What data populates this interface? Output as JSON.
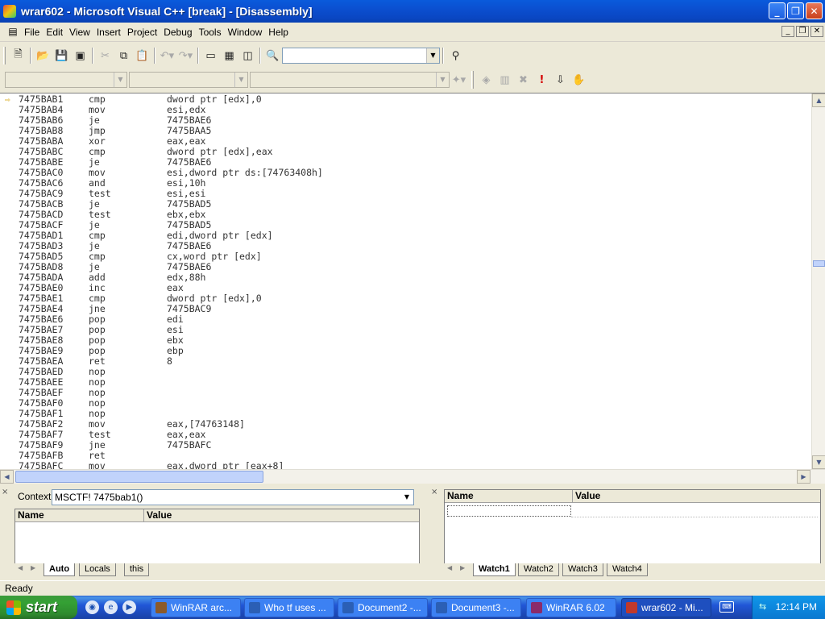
{
  "window": {
    "title": "wrar602 - Microsoft Visual C++ [break] - [Disassembly]"
  },
  "menu": [
    "File",
    "Edit",
    "View",
    "Insert",
    "Project",
    "Debug",
    "Tools",
    "Window",
    "Help"
  ],
  "disassembly": [
    {
      "addr": "7475BAB1",
      "mn": "cmp",
      "op": "dword ptr [edx],0",
      "current": true
    },
    {
      "addr": "7475BAB4",
      "mn": "mov",
      "op": "esi,edx"
    },
    {
      "addr": "7475BAB6",
      "mn": "je",
      "op": "7475BAE6"
    },
    {
      "addr": "7475BAB8",
      "mn": "jmp",
      "op": "7475BAA5"
    },
    {
      "addr": "7475BABA",
      "mn": "xor",
      "op": "eax,eax"
    },
    {
      "addr": "7475BABC",
      "mn": "cmp",
      "op": "dword ptr [edx],eax"
    },
    {
      "addr": "7475BABE",
      "mn": "je",
      "op": "7475BAE6"
    },
    {
      "addr": "7475BAC0",
      "mn": "mov",
      "op": "esi,dword ptr ds:[74763408h]"
    },
    {
      "addr": "7475BAC6",
      "mn": "and",
      "op": "esi,10h"
    },
    {
      "addr": "7475BAC9",
      "mn": "test",
      "op": "esi,esi"
    },
    {
      "addr": "7475BACB",
      "mn": "je",
      "op": "7475BAD5"
    },
    {
      "addr": "7475BACD",
      "mn": "test",
      "op": "ebx,ebx"
    },
    {
      "addr": "7475BACF",
      "mn": "je",
      "op": "7475BAD5"
    },
    {
      "addr": "7475BAD1",
      "mn": "cmp",
      "op": "edi,dword ptr [edx]"
    },
    {
      "addr": "7475BAD3",
      "mn": "je",
      "op": "7475BAE6"
    },
    {
      "addr": "7475BAD5",
      "mn": "cmp",
      "op": "cx,word ptr [edx]"
    },
    {
      "addr": "7475BAD8",
      "mn": "je",
      "op": "7475BAE6"
    },
    {
      "addr": "7475BADA",
      "mn": "add",
      "op": "edx,88h"
    },
    {
      "addr": "7475BAE0",
      "mn": "inc",
      "op": "eax"
    },
    {
      "addr": "7475BAE1",
      "mn": "cmp",
      "op": "dword ptr [edx],0"
    },
    {
      "addr": "7475BAE4",
      "mn": "jne",
      "op": "7475BAC9"
    },
    {
      "addr": "7475BAE6",
      "mn": "pop",
      "op": "edi"
    },
    {
      "addr": "7475BAE7",
      "mn": "pop",
      "op": "esi"
    },
    {
      "addr": "7475BAE8",
      "mn": "pop",
      "op": "ebx"
    },
    {
      "addr": "7475BAE9",
      "mn": "pop",
      "op": "ebp"
    },
    {
      "addr": "7475BAEA",
      "mn": "ret",
      "op": "8"
    },
    {
      "addr": "7475BAED",
      "mn": "nop",
      "op": ""
    },
    {
      "addr": "7475BAEE",
      "mn": "nop",
      "op": ""
    },
    {
      "addr": "7475BAEF",
      "mn": "nop",
      "op": ""
    },
    {
      "addr": "7475BAF0",
      "mn": "nop",
      "op": ""
    },
    {
      "addr": "7475BAF1",
      "mn": "nop",
      "op": ""
    },
    {
      "addr": "7475BAF2",
      "mn": "mov",
      "op": "eax,[74763148]"
    },
    {
      "addr": "7475BAF7",
      "mn": "test",
      "op": "eax,eax"
    },
    {
      "addr": "7475BAF9",
      "mn": "jne",
      "op": "7475BAFC"
    },
    {
      "addr": "7475BAFB",
      "mn": "ret",
      "op": ""
    },
    {
      "addr": "7475BAFC",
      "mn": "mov",
      "op": "eax,dword ptr [eax+8]"
    }
  ],
  "variables": {
    "context_label": "Context:",
    "context_value": "MSCTF! 7475bab1()",
    "col_name": "Name",
    "col_value": "Value",
    "tabs": [
      "Auto",
      "Locals",
      "this"
    ]
  },
  "watch": {
    "col_name": "Name",
    "col_value": "Value",
    "tabs": [
      "Watch1",
      "Watch2",
      "Watch3",
      "Watch4"
    ]
  },
  "status": {
    "text": "Ready"
  },
  "taskbar": {
    "start_label": "start",
    "tasks": [
      {
        "label": "WinRAR arc...",
        "icon_color": "#8b5a2b"
      },
      {
        "label": "Who tf uses ...",
        "icon_color": "#2b5fb5"
      },
      {
        "label": "Document2 -...",
        "icon_color": "#2b5fb5"
      },
      {
        "label": "Document3 -...",
        "icon_color": "#2b5fb5"
      },
      {
        "label": "WinRAR 6.02",
        "icon_color": "#8b2b6a"
      },
      {
        "label": "wrar602 - Mi...",
        "icon_color": "#c0392b",
        "active": true
      }
    ],
    "clock": "12:14 PM"
  }
}
